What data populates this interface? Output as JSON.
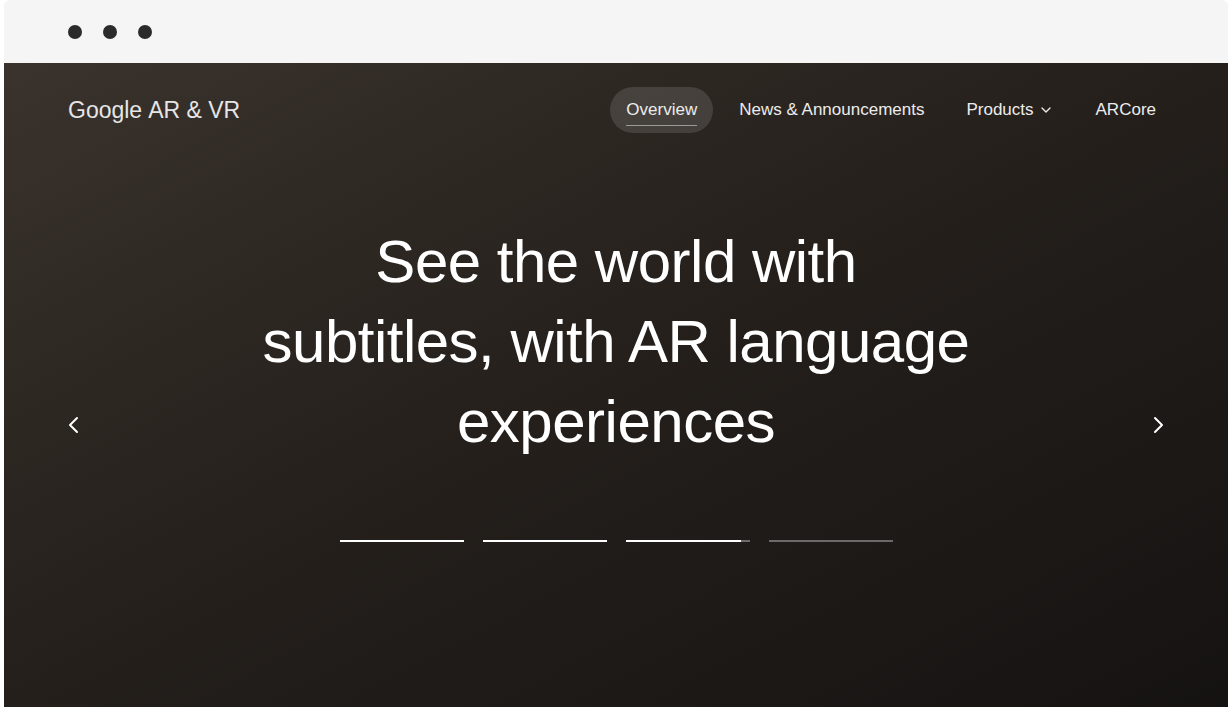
{
  "logo": {
    "brand": "Google",
    "product": "AR & VR"
  },
  "nav": [
    {
      "label": "Overview",
      "selected": true,
      "menu": false
    },
    {
      "label": "News & Announcements",
      "selected": false,
      "menu": false
    },
    {
      "label": "Products",
      "selected": false,
      "menu": true
    },
    {
      "label": "ARCore",
      "selected": false,
      "menu": false
    }
  ],
  "hero": {
    "headline": "See the world with subtitles, with AR language experiences"
  },
  "slides": [
    {
      "level": 1
    },
    {
      "level": 1
    },
    {
      "level": 0.93
    },
    {
      "level": 0
    }
  ]
}
